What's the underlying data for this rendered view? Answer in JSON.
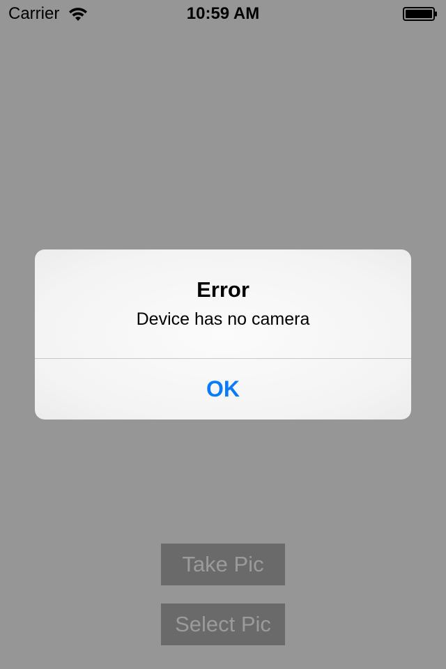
{
  "status_bar": {
    "carrier": "Carrier",
    "time": "10:59 AM",
    "wifi_icon": "wifi-icon",
    "battery_icon": "battery-icon"
  },
  "buttons": {
    "take_pic": "Take Pic",
    "select_pic": "Select Pic"
  },
  "alert": {
    "title": "Error",
    "message": "Device has no camera",
    "ok_label": "OK"
  },
  "colors": {
    "dim_background": "#969696",
    "alert_background": "#f4f4f4",
    "ok_text": "#0a7aff",
    "bg_button": "#6a6a6a",
    "bg_button_text": "#9b9b9b"
  }
}
